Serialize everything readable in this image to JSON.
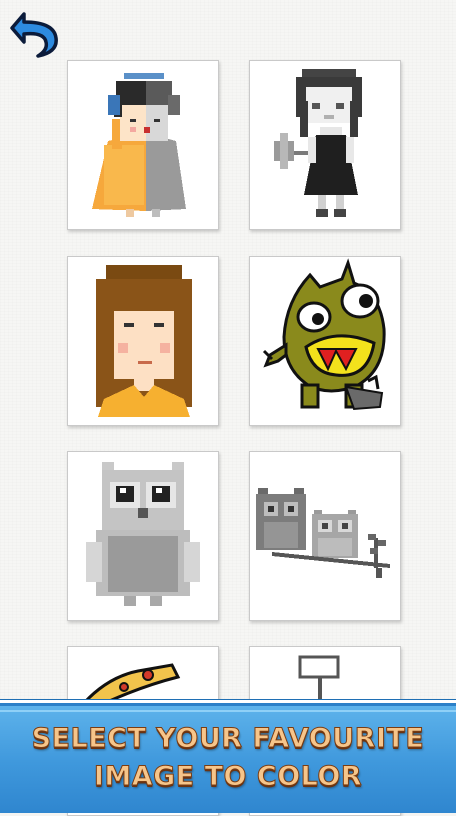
{
  "banner": {
    "line1": "SELECT YOUR FAVOURITE",
    "line2": "IMAGE TO COLOR"
  },
  "icons": {
    "back": "undo-arrow-icon"
  },
  "gallery": {
    "images": [
      {
        "name": "girl-with-headphones"
      },
      {
        "name": "girl-in-black-dress"
      },
      {
        "name": "girl-with-long-hair"
      },
      {
        "name": "green-monster"
      },
      {
        "name": "owl"
      },
      {
        "name": "two-owls-on-branch"
      },
      {
        "name": "pizza-slice"
      },
      {
        "name": "signpost"
      }
    ]
  },
  "colors": {
    "banner_top": "#5fb4ec",
    "banner_bottom": "#2f86cf",
    "banner_text": "#f6c58a",
    "banner_text_outline": "#7a3c12",
    "back_arrow": "#2d8be0"
  }
}
